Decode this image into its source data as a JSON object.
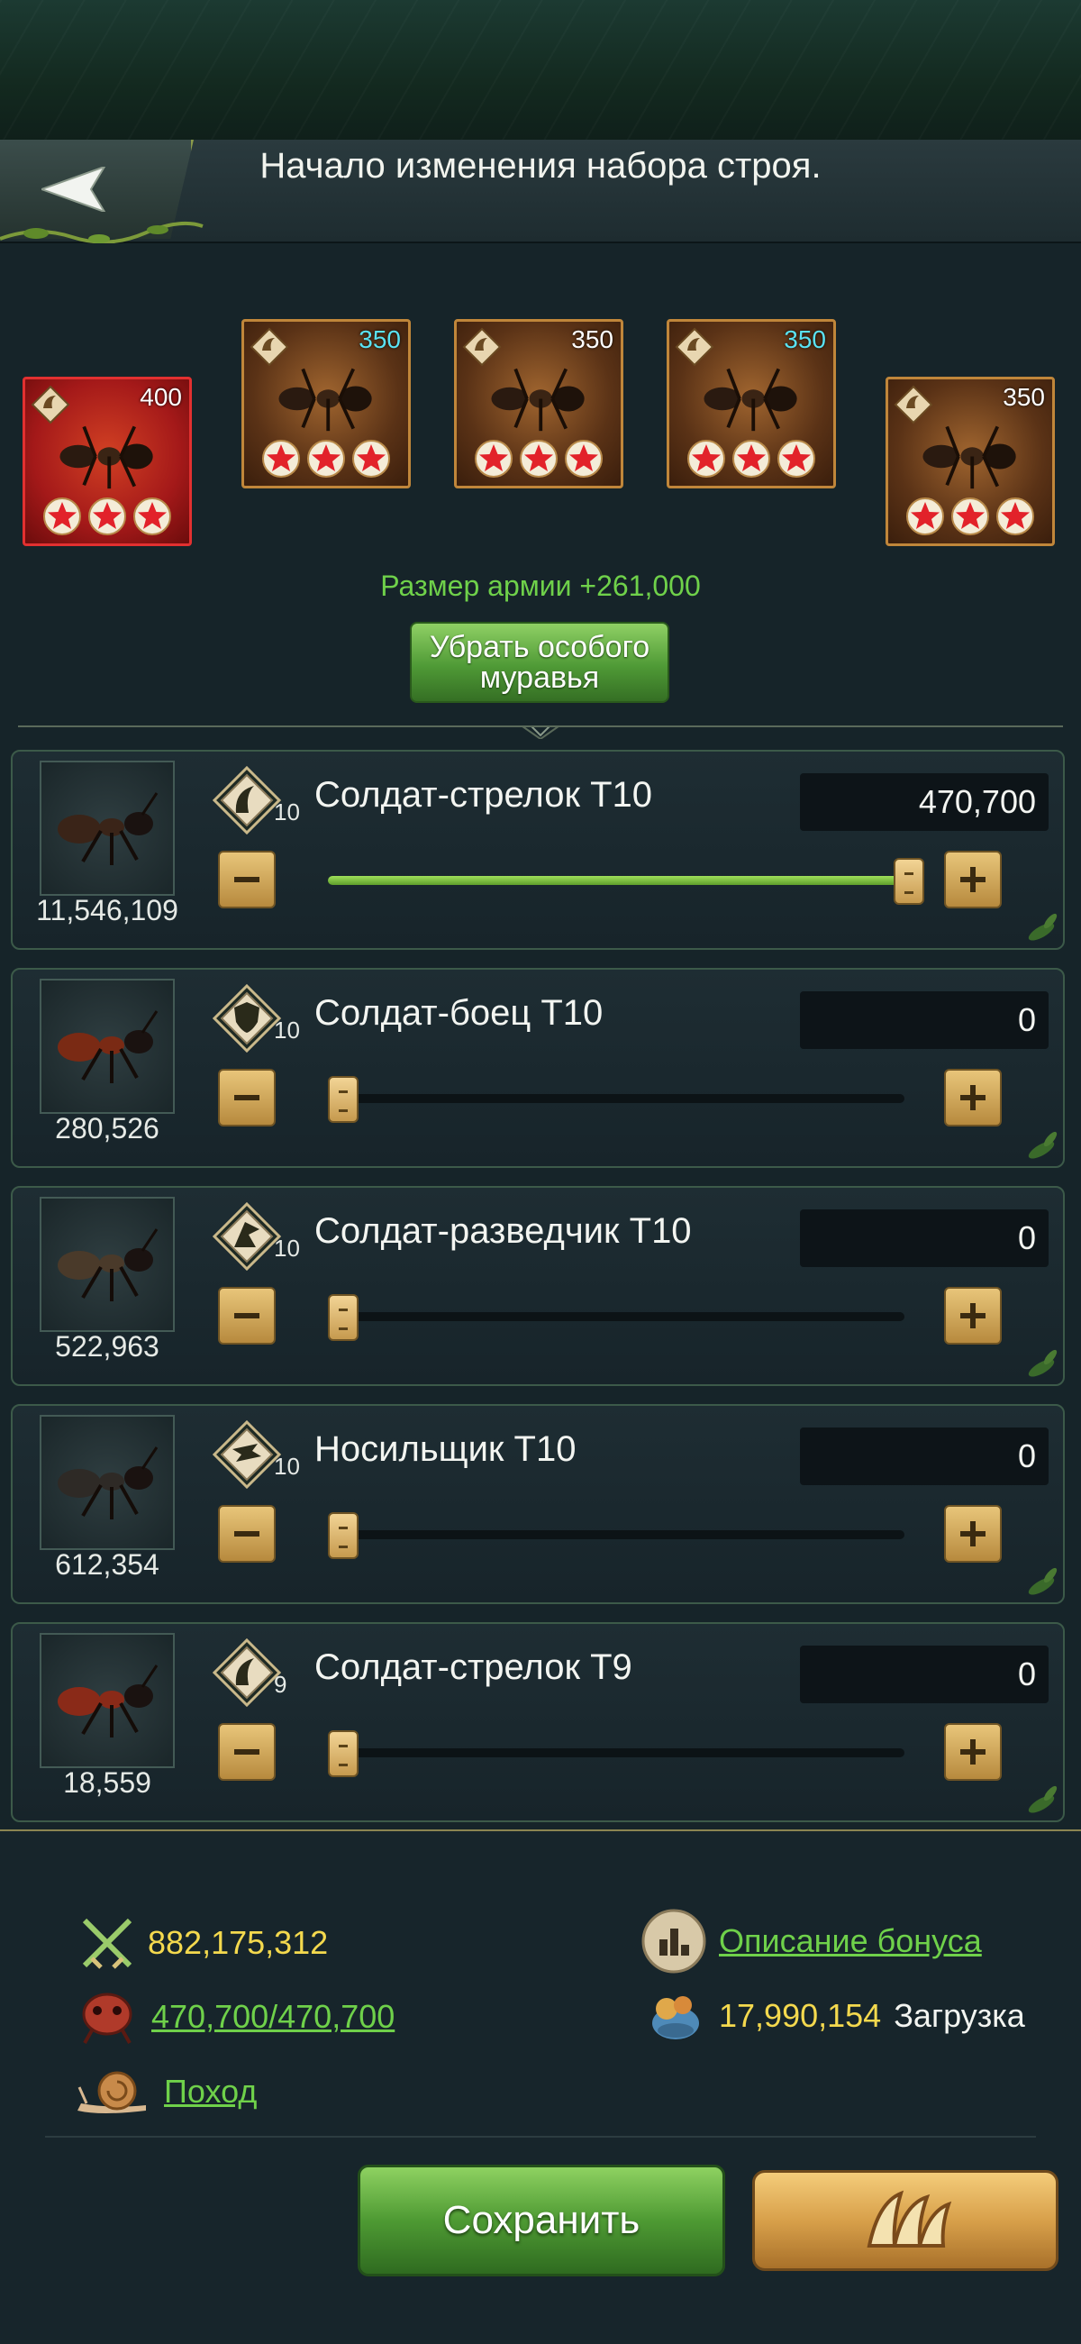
{
  "header": {
    "title": "Начало изменения набора строя."
  },
  "heroes": [
    {
      "value": "400",
      "value_color": "white",
      "frame": "red",
      "stars": 3
    },
    {
      "value": "350",
      "value_color": "cyan",
      "frame": "orange",
      "stars": 3
    },
    {
      "value": "350",
      "value_color": "white",
      "frame": "orange",
      "stars": 3
    },
    {
      "value": "350",
      "value_color": "cyan",
      "frame": "orange",
      "stars": 3
    },
    {
      "value": "350",
      "value_color": "white",
      "frame": "orange",
      "stars": 3
    }
  ],
  "army_size": "Размер армии +261,000",
  "remove_special_ant_button": "Убрать особого муравья",
  "troops": [
    {
      "name": "Солдат-стрелок T10",
      "tier": "10",
      "available": "11,546,109",
      "quantity": "470,700",
      "slider_fraction": 1.0,
      "type_icon": "shooter-icon"
    },
    {
      "name": "Солдат-боец T10",
      "tier": "10",
      "available": "280,526",
      "quantity": "0",
      "slider_fraction": 0,
      "type_icon": "defender-icon"
    },
    {
      "name": "Солдат-разведчик T10",
      "tier": "10",
      "available": "522,963",
      "quantity": "0",
      "slider_fraction": 0,
      "type_icon": "scout-icon"
    },
    {
      "name": "Носильщик T10",
      "tier": "10",
      "available": "612,354",
      "quantity": "0",
      "slider_fraction": 0,
      "type_icon": "carrier-icon"
    },
    {
      "name": "Солдат-стрелок T9",
      "tier": "9",
      "available": "18,559",
      "quantity": "0",
      "slider_fraction": 0,
      "type_icon": "shooter-icon"
    }
  ],
  "stats": {
    "power": "882,175,312",
    "bonus_description": "Описание бонуса",
    "troops_count": "470,700/470,700",
    "load_value": "17,990,154",
    "load_label": "Загрузка",
    "march": "Поход"
  },
  "save_button": "Сохранить",
  "colors": {
    "accent_green": "#6fd14a",
    "power_yellow": "#f4d94e",
    "gold_button": "#d8a04a",
    "hero_red": "#e23030"
  }
}
